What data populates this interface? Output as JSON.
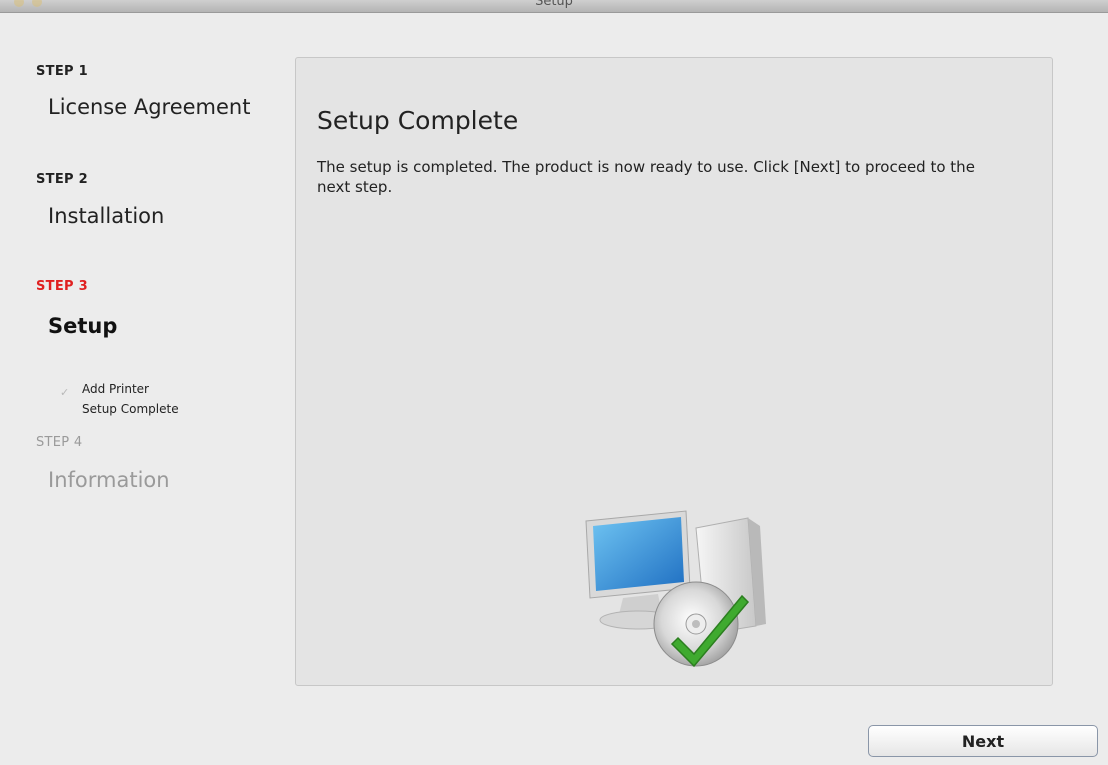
{
  "window": {
    "title": "Setup"
  },
  "steps": [
    {
      "label": "STEP 1",
      "name": "License Agreement",
      "state": "done"
    },
    {
      "label": "STEP 2",
      "name": "Installation",
      "state": "done"
    },
    {
      "label": "STEP 3",
      "name": "Setup",
      "state": "active",
      "substeps": [
        "Add Printer",
        "Setup Complete"
      ]
    },
    {
      "label": "STEP 4",
      "name": "Information",
      "state": "pending"
    }
  ],
  "panel": {
    "title": "Setup Complete",
    "description": "The setup is completed. The product is now ready to use. Click [Next] to proceed to the next step.",
    "illustration_icon": "computer-with-cd-checkmark-icon"
  },
  "buttons": {
    "next": "Next"
  },
  "colors": {
    "active_step": "#e02020",
    "background": "#ececec",
    "panel": "#e4e4e4"
  }
}
